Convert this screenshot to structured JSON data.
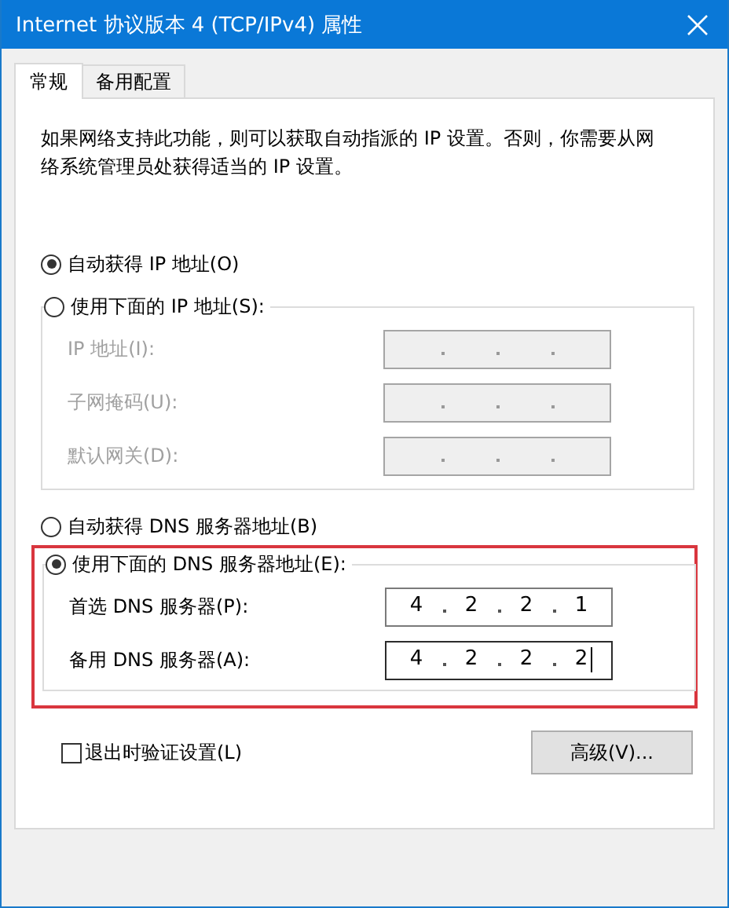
{
  "window": {
    "title": "Internet 协议版本 4 (TCP/IPv4) 属性"
  },
  "tabs": [
    {
      "label": "常规",
      "selected": true
    },
    {
      "label": "备用配置",
      "selected": false
    }
  ],
  "description": "如果网络支持此功能，则可以获取自动指派的 IP 设置。否则，你需要从网络系统管理员处获得适当的 IP 设置。",
  "ip_options": [
    {
      "label": "自动获得 IP 地址(O)",
      "selected": true
    },
    {
      "label": "使用下面的 IP 地址(S):",
      "selected": false
    }
  ],
  "ip_fields": [
    {
      "label": "IP 地址(I):",
      "disabled": true,
      "focused": false
    },
    {
      "label": "子网掩码(U):",
      "disabled": true,
      "focused": false
    },
    {
      "label": "默认网关(D):",
      "disabled": true,
      "focused": false
    }
  ],
  "dns_options": [
    {
      "label": "自动获得 DNS 服务器地址(B)",
      "selected": false
    },
    {
      "label": "使用下面的 DNS 服务器地址(E):",
      "selected": true
    }
  ],
  "dns_highlighted": true,
  "dns_fields": [
    {
      "label": "首选 DNS 服务器(P):",
      "octets": [
        "4",
        "2",
        "2",
        "1"
      ],
      "disabled": false,
      "focused": false
    },
    {
      "label": "备用 DNS 服务器(A):",
      "octets": [
        "4",
        "2",
        "2",
        "2"
      ],
      "disabled": false,
      "focused": true
    }
  ],
  "validate_on_exit": {
    "label": "退出时验证设置(L)",
    "checked": false
  },
  "advanced_button": "高级(V)..."
}
